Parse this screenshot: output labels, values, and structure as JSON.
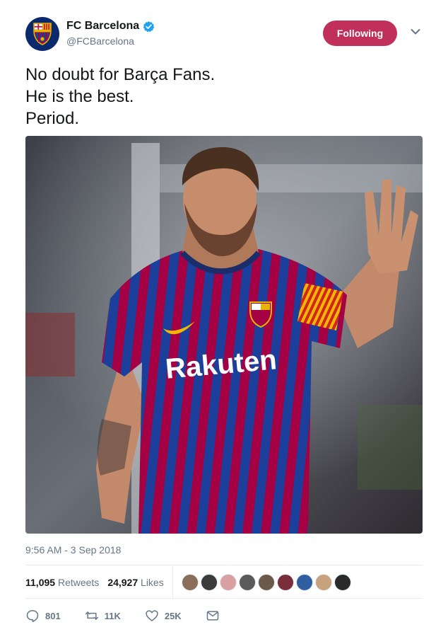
{
  "account": {
    "display_name": "FC Barcelona",
    "handle": "@FCBarcelona",
    "verified": true,
    "avatar_icon": "fc-barcelona-crest-icon"
  },
  "follow_button": {
    "label": "Following",
    "color": "#c1305a"
  },
  "tweet": {
    "lines": [
      "No doubt for Barça Fans.",
      "He is the best.",
      "Period."
    ],
    "media": {
      "description_icon": "photo-player-waving",
      "jersey_text": "Rakuten"
    },
    "timestamp": "9:56 AM - 3 Sep 2018"
  },
  "stats": {
    "retweets_count": "11,095",
    "retweets_label": "Retweets",
    "likes_count": "24,927",
    "likes_label": "Likes",
    "liker_avatar_colors": [
      "#8a6d5a",
      "#3b3b3b",
      "#d8a0a0",
      "#5a5a5a",
      "#6b5a4a",
      "#7a2d3a",
      "#2f5fa0",
      "#c7a27c",
      "#2a2a2a"
    ]
  },
  "actions": {
    "reply_count": "801",
    "retweet_count": "11K",
    "like_count": "25K"
  },
  "colors": {
    "text": "#14171a",
    "muted": "#657786",
    "divider": "#e6ecf0",
    "verified": "#1da1f2"
  }
}
